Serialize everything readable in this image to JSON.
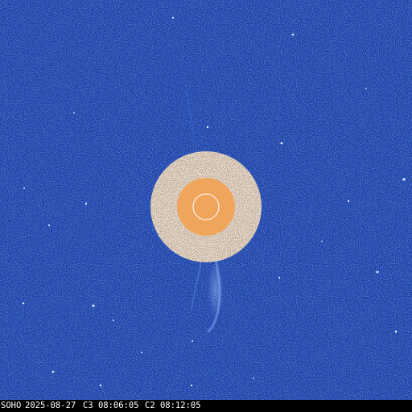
{
  "image": {
    "kind": "LASCO C2/C3 combined coronagraph difference image",
    "colors": {
      "sky": "#1a3ea6",
      "sky_light": "#2c56c9",
      "sky_dark": "#0f2a82",
      "inner_ring_light": "#f4ede4",
      "inner_ring_dark": "#5a3a22",
      "occulter": "#f0a55c",
      "sun_limb": "#ffffff",
      "stars": "#e8f0ff",
      "streamer": "#6c9be8",
      "caption_bg": "#000000",
      "caption_text": "#ffffff"
    }
  },
  "caption": {
    "observatory": "SOHO",
    "date": "2025-08-27",
    "c3": "C3 08:06:05",
    "c2": "C2 08:12:05"
  }
}
